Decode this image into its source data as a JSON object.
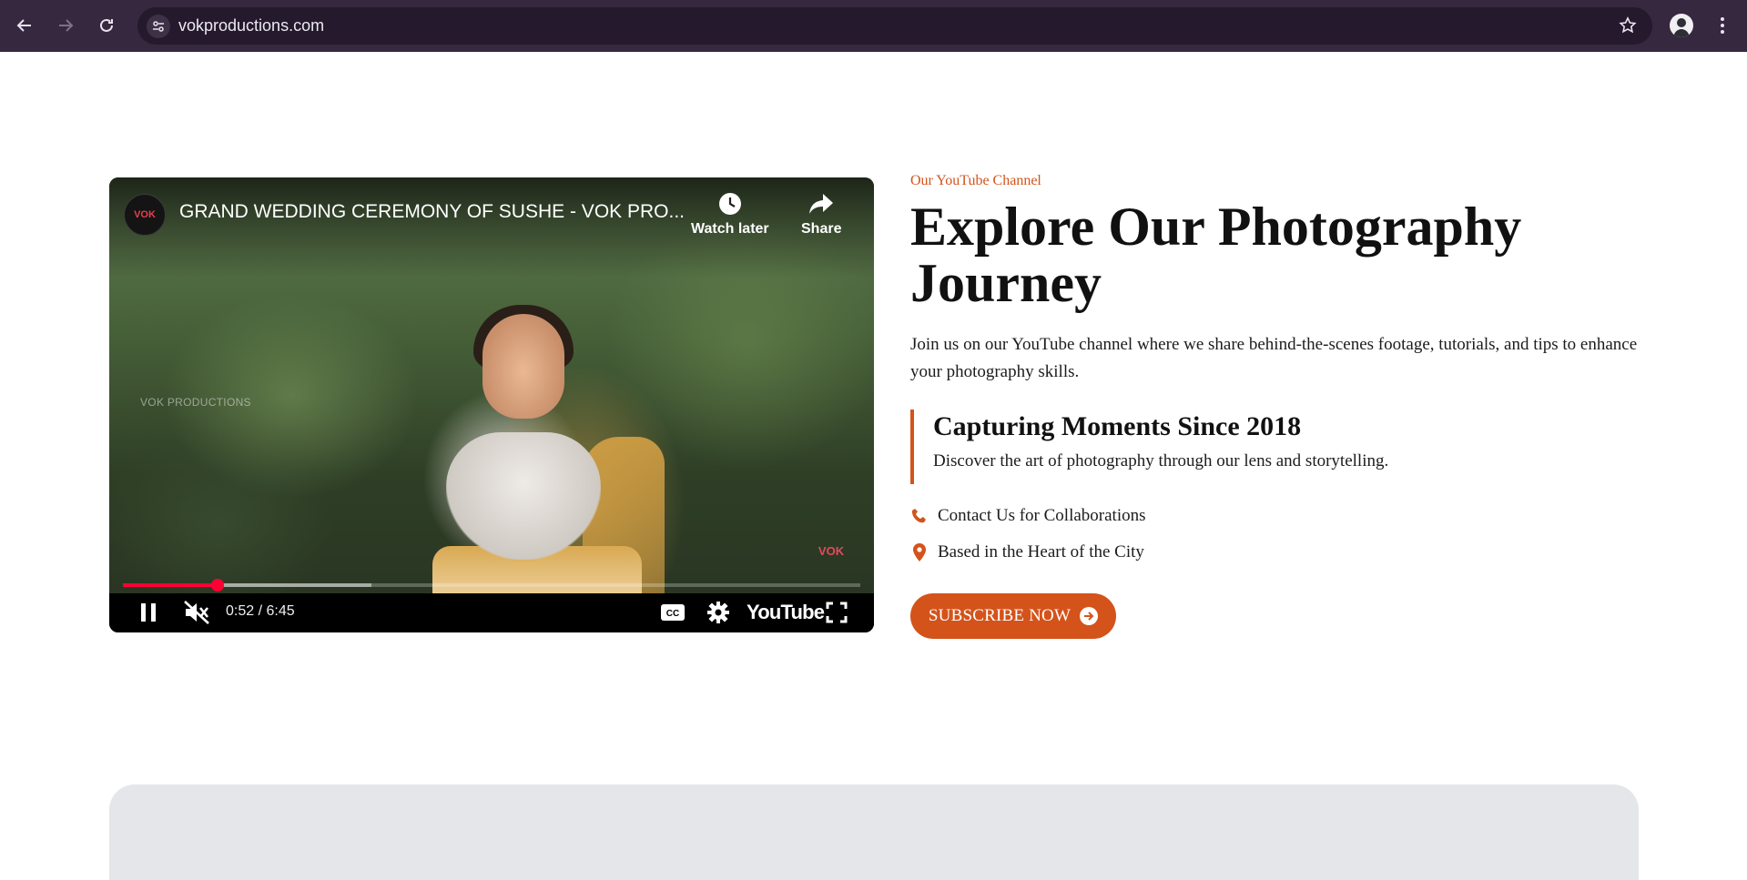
{
  "browser": {
    "url": "vokproductions.com",
    "icons": {
      "back": "back-arrow-icon",
      "forward": "forward-arrow-icon",
      "reload": "reload-icon",
      "site_info": "site-settings-icon",
      "bookmark": "star-icon",
      "menu": "kebab-menu-icon"
    }
  },
  "video": {
    "title": "GRAND WEDDING CEREMONY OF SUSHE - VOK PRO...",
    "channel_logo_text": "VOK",
    "watch_later_label": "Watch later",
    "share_label": "Share",
    "watermark": "VOK PRODUCTIONS",
    "watermark_logo_text": "VOK",
    "time_display": "0:52 / 6:45",
    "progress_played_fraction": 0.128,
    "progress_buffered_fraction": 0.337,
    "brand_text": "YouTube",
    "muted": true,
    "playing": true
  },
  "content": {
    "eyebrow": "Our YouTube Channel",
    "headline": "Explore Our Photography Journey",
    "intro": "Join us on our YouTube channel where we share behind-the-scenes footage, tutorials, and tips to enhance your photography skills.",
    "highlight_title": "Capturing Moments Since 2018",
    "highlight_text": "Discover the art of photography through our lens and storytelling.",
    "info_contact": "Contact Us for Collaborations",
    "info_location": "Based in the Heart of the City",
    "cta_label": "SUBSCRIBE NOW"
  },
  "colors": {
    "accent": "#d4531b",
    "browser_bar": "#35283f",
    "youtube_red": "#ff0033",
    "lower_panel": "#e5e6ea"
  }
}
